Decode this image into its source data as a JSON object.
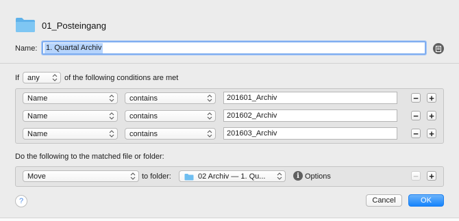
{
  "header": {
    "folder_name": "01_Posteingang",
    "name_label": "Name:",
    "name_value": "1. Quartal Archiv"
  },
  "conditions": {
    "if_label": "If",
    "match_mode": "any",
    "suffix": "of the following conditions are met",
    "rows": [
      {
        "field": "Name",
        "operator": "contains",
        "value": "201601_Archiv"
      },
      {
        "field": "Name",
        "operator": "contains",
        "value": "201602_Archiv"
      },
      {
        "field": "Name",
        "operator": "contains",
        "value": "201603_Archiv"
      }
    ]
  },
  "action": {
    "label": "Do the following to the matched file or folder:",
    "verb": "Move",
    "to_folder_label": "to folder:",
    "target_folder": "02 Archiv — 1. Qu...",
    "options_label": "Options"
  },
  "buttons": {
    "minus": "−",
    "plus": "+",
    "help": "?",
    "cancel": "Cancel",
    "ok": "OK"
  },
  "colors": {
    "folder": "#6fbef0",
    "accent": "#1583fc",
    "selection": "#b6d4fc"
  }
}
